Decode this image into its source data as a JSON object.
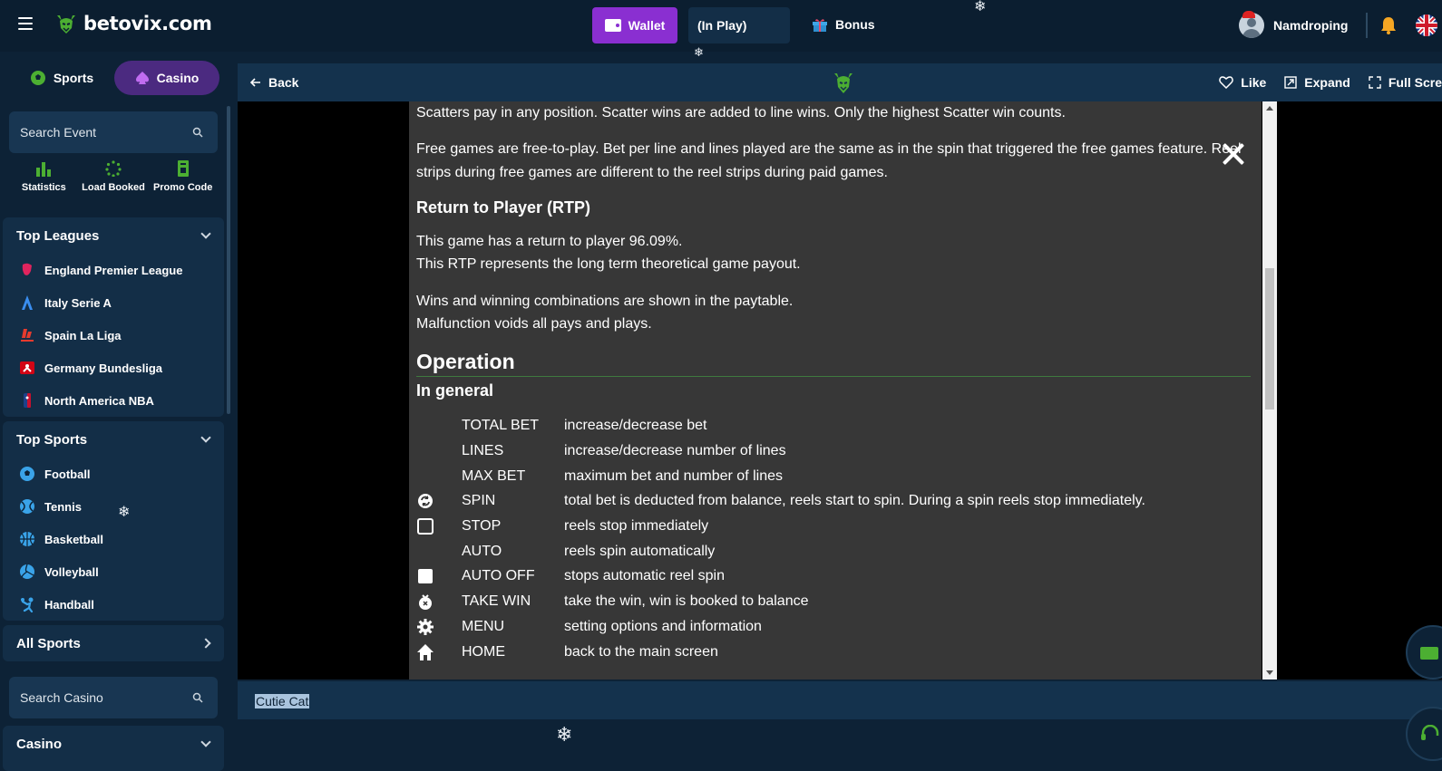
{
  "header": {
    "logo_text": "betovix.com",
    "wallet_label": "Wallet",
    "inplay_label": "(In Play)",
    "bonus_label": "Bonus",
    "username": "Namdroping"
  },
  "sidebar": {
    "tabs": [
      {
        "label": "Sports"
      },
      {
        "label": "Casino"
      }
    ],
    "search_event": "Search Event",
    "quick_links": [
      {
        "label": "Statistics"
      },
      {
        "label": "Load Booked"
      },
      {
        "label": "Promo Code"
      }
    ],
    "top_leagues": {
      "title": "Top Leagues",
      "items": [
        {
          "label": "England Premier League"
        },
        {
          "label": "Italy Serie A"
        },
        {
          "label": "Spain La Liga"
        },
        {
          "label": "Germany Bundesliga"
        },
        {
          "label": "North America NBA"
        }
      ]
    },
    "top_sports": {
      "title": "Top Sports",
      "items": [
        {
          "label": "Football"
        },
        {
          "label": "Tennis"
        },
        {
          "label": "Basketball"
        },
        {
          "label": "Volleyball"
        },
        {
          "label": "Handball"
        }
      ]
    },
    "all_sports": "All Sports",
    "search_casino": "Search Casino",
    "casino_section": "Casino"
  },
  "game_header": {
    "back_label": "Back",
    "like_label": "Like",
    "expand_label": "Expand",
    "fullscreen_label": "Full Scre"
  },
  "help": {
    "p1": "Scatters pay in any position. Scatter wins are added to line wins. Only the highest Scatter win counts.",
    "p2a": "Free games are free-to-play. Bet per line and lines played are the same as in the spin that triggered the free games feature. Reel",
    "p2b": "strips during free games are different to the reel strips during paid games.",
    "rtp_title": "Return to Player (RTP)",
    "rtp1": "This game has a return to player 96.09%.",
    "rtp2": "This RTP represents the long term theoretical game payout.",
    "wins1": "Wins and winning combinations are shown in the paytable.",
    "wins2": "Malfunction voids all pays and plays.",
    "operation_title": "Operation",
    "general_title": "In general",
    "controls": [
      {
        "key": "TOTAL BET",
        "desc": "increase/decrease bet",
        "icon": "none"
      },
      {
        "key": "LINES",
        "desc": "increase/decrease number of lines",
        "icon": "none"
      },
      {
        "key": "MAX BET",
        "desc": "maximum bet and number of lines",
        "icon": "none"
      },
      {
        "key": "SPIN",
        "desc": "total bet is deducted from balance, reels start to spin. During a spin reels stop immediately.",
        "icon": "spin-icon"
      },
      {
        "key": "STOP",
        "desc": "reels stop immediately",
        "icon": "stop-icon"
      },
      {
        "key": "AUTO",
        "desc": "reels spin automatically",
        "icon": "none"
      },
      {
        "key": "AUTO OFF",
        "desc": "stops automatic reel spin",
        "icon": "auto-off-icon"
      },
      {
        "key": "TAKE WIN",
        "desc": "take the win, win is booked to balance",
        "icon": "take-win-icon"
      },
      {
        "key": "MENU",
        "desc": "setting options and information",
        "icon": "gear-icon"
      },
      {
        "key": "HOME",
        "desc": "back to the main screen",
        "icon": "home-icon"
      }
    ]
  },
  "game_title": "Cutie Cat",
  "colors": {
    "accent_purple": "#8a2fd1",
    "sidebar_bg": "#0d2236",
    "panel_bg": "#373737",
    "brand_green": "#4caf32"
  }
}
